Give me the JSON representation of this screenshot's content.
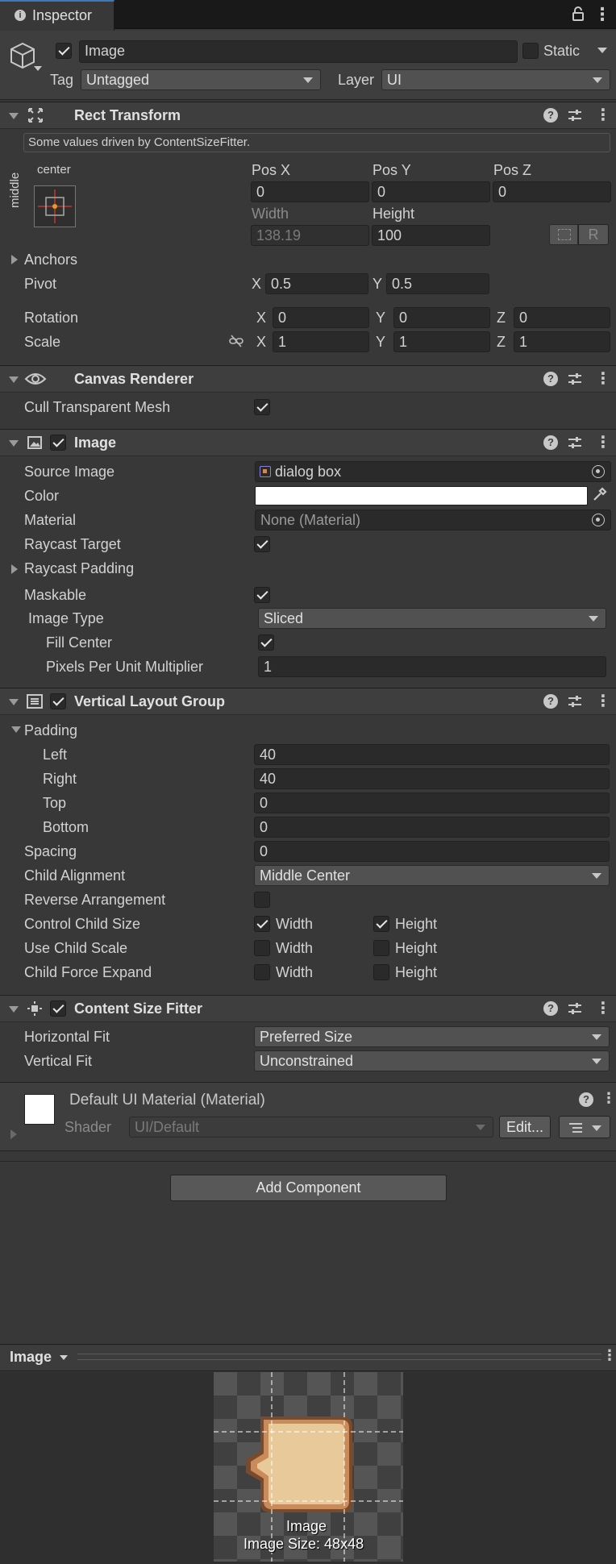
{
  "tab": {
    "title": "Inspector",
    "info_icon": "info-icon",
    "lock_icon": "lock-icon",
    "menu_icon": "kebab-icon"
  },
  "object": {
    "name": "Image",
    "active": true,
    "static_label": "Static",
    "static": false,
    "tag_label": "Tag",
    "tag_value": "Untagged",
    "layer_label": "Layer",
    "layer_value": "UI"
  },
  "rect_transform": {
    "title": "Rect Transform",
    "notice": "Some values driven by ContentSizeFitter.",
    "anchor_h": "center",
    "anchor_v": "middle",
    "posx_label": "Pos X",
    "posx": "0",
    "posy_label": "Pos Y",
    "posy": "0",
    "posz_label": "Pos Z",
    "posz": "0",
    "width_label": "Width",
    "width": "138.19",
    "height_label": "Height",
    "height": "100",
    "r_button": "R",
    "anchors_label": "Anchors",
    "pivot_label": "Pivot",
    "pivot_x": "0.5",
    "pivot_y": "0.5",
    "rotation_label": "Rotation",
    "rot_x": "0",
    "rot_y": "0",
    "rot_z": "0",
    "scale_label": "Scale",
    "scale_x": "1",
    "scale_y": "1",
    "scale_z": "1",
    "axis_x": "X",
    "axis_y": "Y",
    "axis_z": "Z"
  },
  "canvas_renderer": {
    "title": "Canvas Renderer",
    "cull_label": "Cull Transparent Mesh",
    "cull": true
  },
  "image": {
    "title": "Image",
    "enabled": true,
    "source_label": "Source Image",
    "source_value": "dialog box",
    "color_label": "Color",
    "color_value": "#ffffff",
    "material_label": "Material",
    "material_value": "None (Material)",
    "raycast_label": "Raycast Target",
    "raycast": true,
    "raycast_padding_label": "Raycast Padding",
    "maskable_label": "Maskable",
    "maskable": true,
    "type_label": "Image Type",
    "type_value": "Sliced",
    "fill_label": "Fill Center",
    "fill": true,
    "ppu_label": "Pixels Per Unit Multiplier",
    "ppu_value": "1"
  },
  "vlg": {
    "title": "Vertical Layout Group",
    "enabled": true,
    "padding_label": "Padding",
    "left_label": "Left",
    "left": "40",
    "right_label": "Right",
    "right": "40",
    "top_label": "Top",
    "top": "0",
    "bottom_label": "Bottom",
    "bottom": "0",
    "spacing_label": "Spacing",
    "spacing": "0",
    "align_label": "Child Alignment",
    "align_value": "Middle Center",
    "reverse_label": "Reverse Arrangement",
    "ccs_label": "Control Child Size",
    "ucs_label": "Use Child Scale",
    "cfe_label": "Child Force Expand",
    "width_label": "Width",
    "height_label": "Height",
    "ccs_w": true,
    "ccs_h": true,
    "ucs_w": false,
    "ucs_h": false,
    "cfe_w": false,
    "cfe_h": false
  },
  "csf": {
    "title": "Content Size Fitter",
    "enabled": true,
    "hfit_label": "Horizontal Fit",
    "hfit_value": "Preferred Size",
    "vfit_label": "Vertical Fit",
    "vfit_value": "Unconstrained"
  },
  "material": {
    "title": "Default UI Material (Material)",
    "shader_label": "Shader",
    "shader_value": "UI/Default",
    "edit_button": "Edit..."
  },
  "add_component": "Add Component",
  "preview": {
    "dropdown": "Image",
    "caption": "Image",
    "size_text": "Image Size: 48x48"
  },
  "colors": {
    "panel": "#383838",
    "header": "#3e3e3e",
    "field": "#2a2a2a",
    "sprite_fill": "#e8c99a",
    "sprite_border": "#c98b5a",
    "sprite_dark": "#7a4a2c"
  }
}
